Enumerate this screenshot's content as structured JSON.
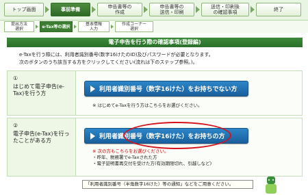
{
  "steps": {
    "main": [
      {
        "label": "トップ画面"
      },
      {
        "label": "事前準備"
      },
      {
        "label": "申告書等の\n作成"
      },
      {
        "label": "申告書等の\n送信・印刷"
      },
      {
        "label": "送信・印刷後\nの確認事項"
      },
      {
        "label": "終了"
      }
    ],
    "sub": [
      {
        "label": "提出方法\n選択"
      },
      {
        "label": "e-Tax等の選択"
      },
      {
        "label": "基本情報\n入力"
      },
      {
        "label": "作成コーナー\n選択"
      }
    ]
  },
  "page": {
    "title": "電子申告を行う際の確認事項(登録編)",
    "intro_line1": "e-Taxを行う際には、利用者識別番号(数字16けたのID)及びパスワードが必要となります。",
    "intro_line2": "次のボタンのうち該当する方をクリックしてください(流れは下のステップ参照。)。"
  },
  "option1": {
    "number": "①",
    "label": "はじめて電子申告(e-Tax)を行う方",
    "button": "利用者識別番号（数字16けた）をお持ちでない方",
    "note": "※ はじめてe-Taxを行う方はこちらをお選びください。"
  },
  "option2": {
    "number": "②",
    "label": "電子申告(e-Tax)を行ったことがある方",
    "button": "利用者識別番号（数字16けた）をお持ちの方",
    "note_head": "※ 次の方もこちらをお選びください。",
    "note_items": [
      "・昨年、税務署でe-Taxされた方",
      "・電子証明書再交付を受けた方(有効期限切れ、引越しなど)"
    ]
  },
  "notice": "「利用者識別番号（半角数字16けた）等の通知」などをご用意ください。",
  "colors": {
    "accent_green": "#2a6f2a",
    "button_blue": "#1a5f9c",
    "highlight_red": "#d6121c"
  }
}
